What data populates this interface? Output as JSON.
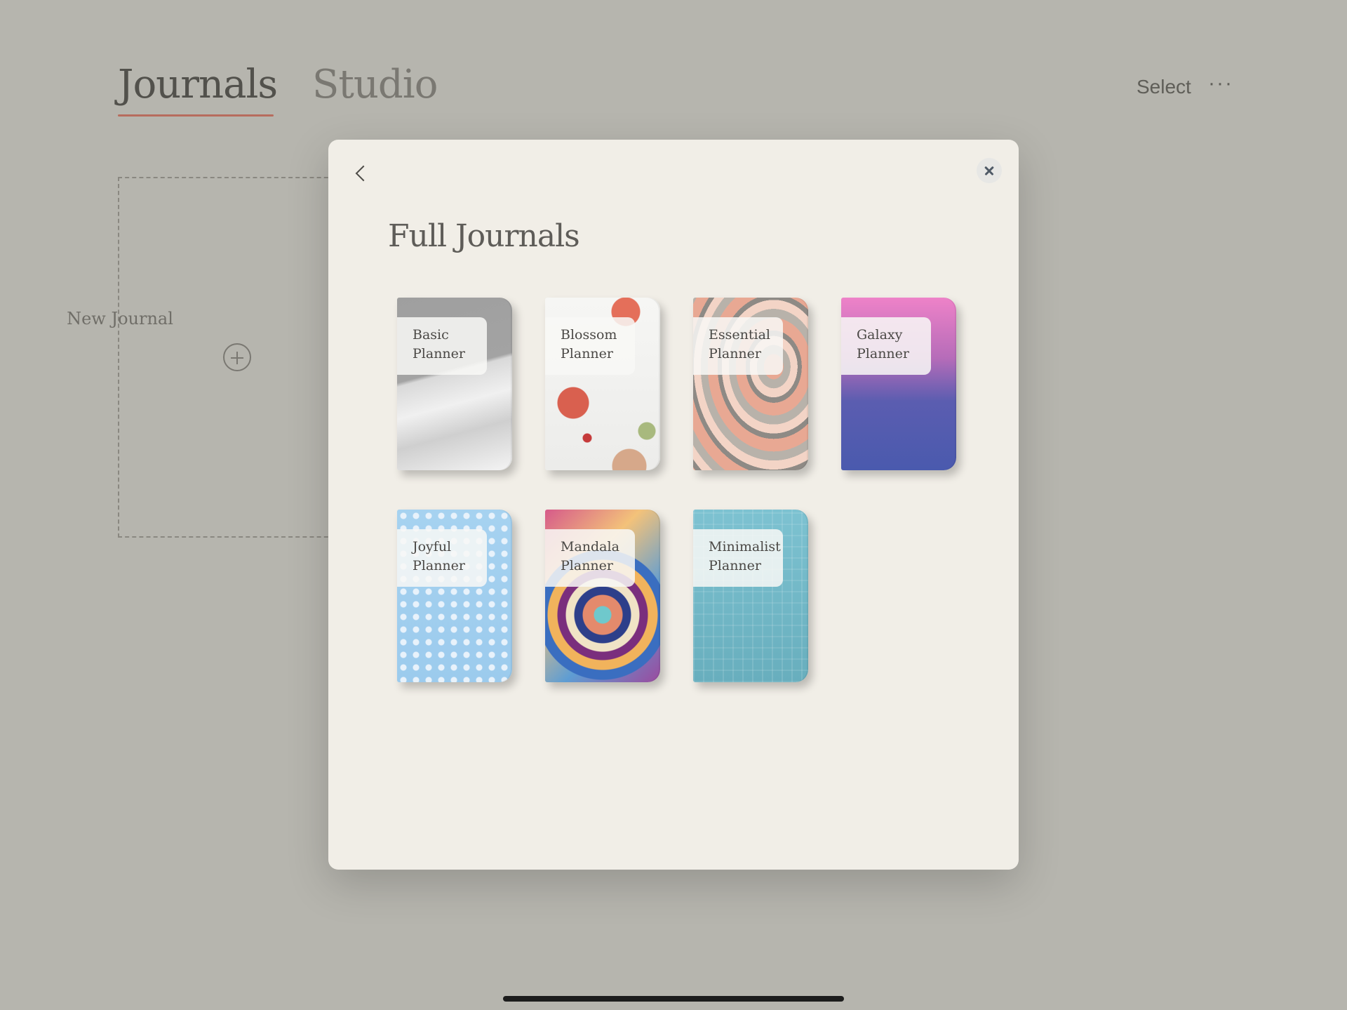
{
  "header": {
    "tabs": [
      {
        "label": "Journals",
        "active": true
      },
      {
        "label": "Studio",
        "active": false
      }
    ],
    "select_label": "Select",
    "more_label": "···"
  },
  "new_journal": {
    "label": "New Journal"
  },
  "modal": {
    "title": "Full Journals",
    "planners": [
      {
        "line1": "Basic",
        "line2": "Planner"
      },
      {
        "line1": "Blossom",
        "line2": "Planner"
      },
      {
        "line1": "Essential",
        "line2": "Planner"
      },
      {
        "line1": "Galaxy",
        "line2": "Planner"
      },
      {
        "line1": "Joyful",
        "line2": "Planner"
      },
      {
        "line1": "Mandala",
        "line2": "Planner"
      },
      {
        "line1": "Minimalist",
        "line2": "Planner"
      }
    ]
  },
  "colors": {
    "accent_underline": "#c56a5b",
    "modal_bg": "#f1eee7",
    "page_bg": "#c4c3bc"
  }
}
